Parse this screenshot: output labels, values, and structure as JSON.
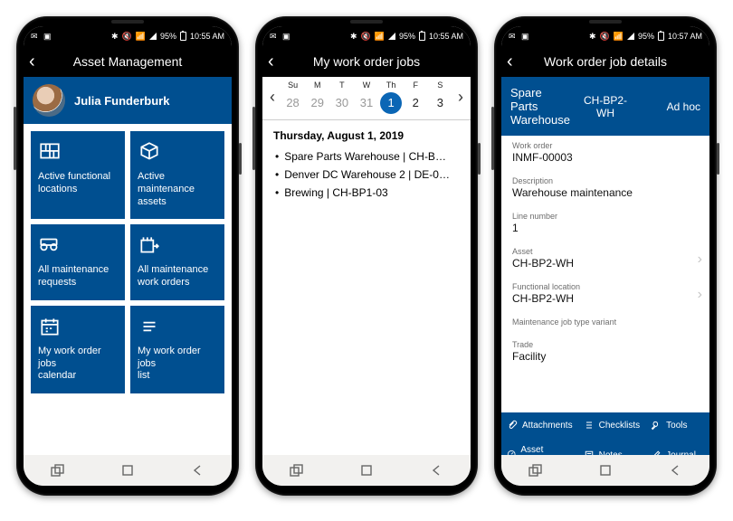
{
  "status": {
    "battery_pct": "95%",
    "time": "10:55 AM",
    "time3": "10:57 AM"
  },
  "phone1": {
    "title": "Asset Management",
    "user": "Julia Funderburk",
    "tiles": [
      {
        "label": "Active functional\nlocations"
      },
      {
        "label": "Active maintenance\nassets"
      },
      {
        "label": "All maintenance\nrequests"
      },
      {
        "label": "All maintenance\nwork orders"
      },
      {
        "label": "My work order jobs\ncalendar"
      },
      {
        "label": "My work order jobs\nlist"
      }
    ]
  },
  "phone2": {
    "title": "My work order jobs",
    "day_names": [
      "Su",
      "M",
      "T",
      "W",
      "Th",
      "F",
      "S"
    ],
    "days": [
      {
        "n": "28",
        "cls": ""
      },
      {
        "n": "29",
        "cls": ""
      },
      {
        "n": "30",
        "cls": ""
      },
      {
        "n": "31",
        "cls": ""
      },
      {
        "n": "1",
        "cls": "inmonth sel"
      },
      {
        "n": "2",
        "cls": "inmonth"
      },
      {
        "n": "3",
        "cls": "inmonth"
      }
    ],
    "date_title": "Thursday, August 1, 2019",
    "events": [
      "Spare Parts Warehouse | CH-B…",
      "Denver DC Warehouse 2 | DE-0…",
      "Brewing | CH-BP1-03"
    ]
  },
  "phone3": {
    "title": "Work order job details",
    "header": {
      "left": "Spare Parts\nWarehouse",
      "mid": "CH-BP2-WH",
      "right": "Ad hoc"
    },
    "fields": [
      {
        "lab": "Work order",
        "val": "INMF-00003"
      },
      {
        "lab": "Description",
        "val": "Warehouse maintenance"
      },
      {
        "lab": "Line number",
        "val": "1"
      },
      {
        "lab": "Asset",
        "val": "CH-BP2-WH",
        "link": true
      },
      {
        "lab": "Functional location",
        "val": "CH-BP2-WH",
        "link": true
      },
      {
        "lab": "Maintenance job type variant",
        "val": ""
      },
      {
        "lab": "Trade",
        "val": "Facility"
      }
    ],
    "actions": [
      {
        "name": "attachments",
        "label": "Attachments",
        "icon": "clip"
      },
      {
        "name": "checklists",
        "label": "Checklists",
        "icon": "list"
      },
      {
        "name": "tools",
        "label": "Tools",
        "icon": "wrench"
      },
      {
        "name": "asset-counters",
        "label": "Asset counters",
        "icon": "gauge"
      },
      {
        "name": "notes",
        "label": "Notes",
        "icon": "note"
      },
      {
        "name": "journal",
        "label": "Journal",
        "icon": "pen"
      }
    ]
  }
}
